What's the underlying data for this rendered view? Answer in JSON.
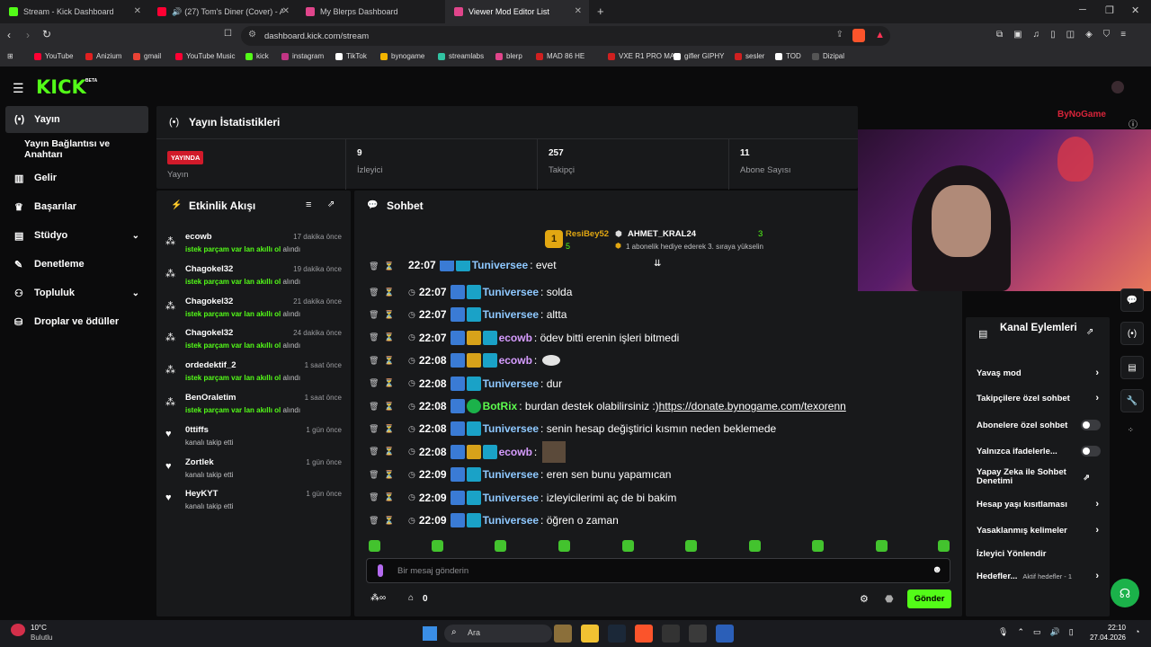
{
  "browser": {
    "tabs": [
      {
        "title": "Stream - Kick Dashboard",
        "color": "#53fc18",
        "active": false
      },
      {
        "title": "(27) Tom's Diner (Cover) - Annen",
        "color": "#ff0033",
        "active": false
      },
      {
        "title": "My Blerps Dashboard",
        "color": "#e0458b",
        "active": false
      },
      {
        "title": "Viewer Mod Editor List",
        "color": "#e0458b",
        "active": true
      }
    ],
    "new_tab": "+",
    "url": "dashboard.kick.com/stream",
    "bookmarks": [
      {
        "label": "YouTube",
        "color": "#ff0033"
      },
      {
        "label": "Anizium",
        "color": "#e02020"
      },
      {
        "label": "gmail",
        "color": "#ea4335"
      },
      {
        "label": "YouTube Music",
        "color": "#ff0033"
      },
      {
        "label": "kick",
        "color": "#53fc18"
      },
      {
        "label": "instagram",
        "color": "#c13584"
      },
      {
        "label": "TikTok",
        "color": "#ffffff"
      },
      {
        "label": "bynogame",
        "color": "#f3b500"
      },
      {
        "label": "streamlabs",
        "color": "#31c3a2"
      },
      {
        "label": "blerp",
        "color": "#e0458b"
      },
      {
        "label": "MAD 86 HE",
        "color": "#d02020"
      },
      {
        "label": "VXE R1 PRO MAX",
        "color": "#d02020"
      },
      {
        "label": "gifler GIPHY",
        "color": "#ffffff"
      },
      {
        "label": "sesler",
        "color": "#d02020"
      },
      {
        "label": "TOD",
        "color": "#ffffff"
      },
      {
        "label": "Dizipal",
        "color": "#555555"
      }
    ]
  },
  "app": {
    "logo": "KICK",
    "logo_tag": "BETA",
    "accent": "#53fc18",
    "sidebar": [
      {
        "label": "Yayın",
        "icon": "broadcast-icon",
        "active": true
      },
      {
        "label": "Yayın Bağlantısı ve Anahtarı",
        "icon": "",
        "active": false
      },
      {
        "label": "Gelir",
        "icon": "chart-icon",
        "active": false
      },
      {
        "label": "Başarılar",
        "icon": "trophy-icon",
        "active": false
      },
      {
        "label": "Stüdyo",
        "icon": "studio-icon",
        "active": false,
        "chevron": "⌄"
      },
      {
        "label": "Denetleme",
        "icon": "wrench-icon",
        "active": false
      },
      {
        "label": "Topluluk",
        "icon": "community-icon",
        "active": false,
        "chevron": "⌄"
      },
      {
        "label": "Droplar ve ödüller",
        "icon": "drops-icon",
        "active": false
      }
    ],
    "stats": {
      "title": "Yayın İstatistikleri",
      "live_badge": "YAYINDA",
      "live_label": "Yayın",
      "viewers_value": "9",
      "viewers_label": "İzleyici",
      "followers_value": "257",
      "followers_label": "Takipçi",
      "subs_value": "11",
      "subs_label": "Abone Sayısı"
    },
    "activity": {
      "title": "Etkinlik Akışı",
      "items": [
        {
          "name": "ecowb",
          "time": "17 dakika önce",
          "highlight": "istek parçam var lan akıllı ol",
          "suffix": " alındı",
          "icon": "redeem-icon"
        },
        {
          "name": "Chagokel32",
          "time": "19 dakika önce",
          "highlight": "istek parçam var lan akıllı ol",
          "suffix": " alındı",
          "icon": "redeem-icon"
        },
        {
          "name": "Chagokel32",
          "time": "21 dakika önce",
          "highlight": "istek parçam var lan akıllı ol",
          "suffix": " alındı",
          "icon": "redeem-icon"
        },
        {
          "name": "Chagokel32",
          "time": "24 dakika önce",
          "highlight": "istek parçam var lan akıllı ol",
          "suffix": " alındı",
          "icon": "redeem-icon"
        },
        {
          "name": "ordedektif_2",
          "time": "1 saat önce",
          "highlight": "istek parçam var lan akıllı ol",
          "suffix": " alındı",
          "icon": "redeem-icon"
        },
        {
          "name": "BenOraletim",
          "time": "1 saat önce",
          "highlight": "istek parçam var lan akıllı ol",
          "suffix": " alındı",
          "icon": "redeem-icon"
        },
        {
          "name": "0ttiffs",
          "time": "1 gün önce",
          "highlight": "",
          "suffix": "kanalı takip etti",
          "icon": "heart-icon"
        },
        {
          "name": "Zortlek",
          "time": "1 gün önce",
          "highlight": "",
          "suffix": "kanalı takip etti",
          "icon": "heart-icon"
        },
        {
          "name": "HeyKYT",
          "time": "1 gün önce",
          "highlight": "",
          "suffix": "kanalı takip etti",
          "icon": "heart-icon"
        }
      ]
    },
    "chat": {
      "title": "Sohbet",
      "leader": {
        "rank": "1",
        "user": "ResiBey52",
        "count": "5",
        "gifter": "AHMET_KRAL24",
        "gifter_count": "3",
        "note": "1 abonelik hediye ederek 3. sıraya yükselin"
      },
      "partial_top": {
        "time": "22:07",
        "user": "Tuniversee",
        "text": ": evet"
      },
      "messages": [
        {
          "time": "22:07",
          "user": "Tuniversee",
          "cls": "u-tun",
          "badges": [
            "b-blue",
            "b-og"
          ],
          "text": ": solda"
        },
        {
          "time": "22:07",
          "user": "Tuniversee",
          "cls": "u-tun",
          "badges": [
            "b-blue",
            "b-og"
          ],
          "text": ": altta"
        },
        {
          "time": "22:07",
          "user": "ecowb",
          "cls": "u-eco",
          "badges": [
            "b-blue",
            "b-gold",
            "b-og"
          ],
          "text": ": ödev bitti erenin işleri bitmedi"
        },
        {
          "time": "22:08",
          "user": "ecowb",
          "cls": "u-eco",
          "badges": [
            "b-blue",
            "b-gold",
            "b-og"
          ],
          "text": ":",
          "emote": "sticker"
        },
        {
          "time": "22:08",
          "user": "Tuniversee",
          "cls": "u-tun",
          "badges": [
            "b-blue",
            "b-og"
          ],
          "text": ": dur"
        },
        {
          "time": "22:08",
          "user": "BotRix",
          "cls": "u-bot",
          "badges": [
            "b-blue",
            "b-green"
          ],
          "text": ": burdan destek olabilirsiniz :) ",
          "link": "https://donate.bynogame.com/texorenn"
        },
        {
          "time": "22:08",
          "user": "Tuniversee",
          "cls": "u-tun",
          "badges": [
            "b-blue",
            "b-og"
          ],
          "text": ": senin hesap değiştirici kısmın neden beklemede"
        },
        {
          "time": "22:08",
          "user": "ecowb",
          "cls": "u-eco",
          "badges": [
            "b-blue",
            "b-gold",
            "b-og"
          ],
          "text": ":",
          "emote": "photo"
        },
        {
          "time": "22:09",
          "user": "Tuniversee",
          "cls": "u-tun",
          "badges": [
            "b-blue",
            "b-og"
          ],
          "text": ": eren sen bunu yapamıcan"
        },
        {
          "time": "22:09",
          "user": "Tuniversee",
          "cls": "u-tun",
          "badges": [
            "b-blue",
            "b-og"
          ],
          "text": ": izleyicilerimi aç de bi bakim"
        },
        {
          "time": "22:09",
          "user": "Tuniversee",
          "cls": "u-tun",
          "badges": [
            "b-blue",
            "b-og"
          ],
          "text": ": öğren o zaman"
        }
      ],
      "input_placeholder": "Bir mesaj gönderin",
      "points": "0",
      "send_label": "Gönder"
    },
    "channel_actions": {
      "title": "Kanal Eylemleri",
      "items": [
        {
          "label": "Yavaş mod",
          "type": "chevron"
        },
        {
          "label": "Takipçilere özel sohbet",
          "type": "chevron"
        },
        {
          "label": "Abonelere özel sohbet",
          "type": "toggle"
        },
        {
          "label": "Yalnızca ifadelerle...",
          "type": "toggle"
        },
        {
          "label": "Yapay Zeka ile Sohbet Denetimi",
          "type": "external"
        },
        {
          "label": "Hesap yaşı kısıtlaması",
          "type": "chevron"
        },
        {
          "label": "Yasaklanmış kelimeler",
          "type": "chevron"
        },
        {
          "label": "İzleyici Yönlendir",
          "type": "none"
        },
        {
          "label": "Hedefler...",
          "type": "chevron",
          "extra": "Aktif hedefler - 1"
        }
      ]
    },
    "overlay_text": "ByNoGame"
  },
  "taskbar": {
    "weather_temp": "10°C",
    "weather_desc": "Bulutlu",
    "search_label": "Ara",
    "time": "22:10",
    "date": "27.04.2026"
  }
}
